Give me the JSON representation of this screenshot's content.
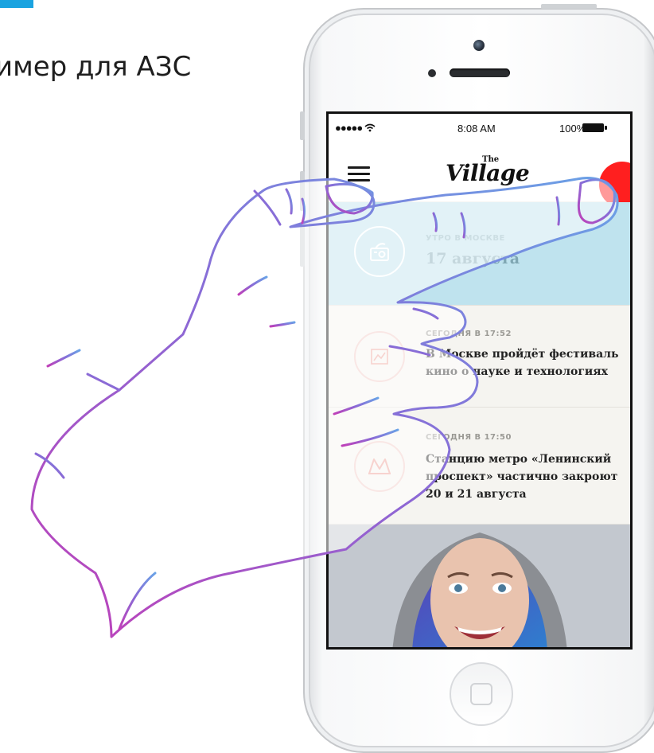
{
  "page": {
    "heading": "имер для АЗС"
  },
  "colors": {
    "accent": "#1aa3e0",
    "notify": "#ff1f1f",
    "feed_highlight": "#bfe3ee",
    "hand_stroke_start": "#b845c6",
    "hand_stroke_end": "#6fa0e0"
  },
  "status_bar": {
    "signal": "●●●●● ",
    "wifi_icon": "wifi-icon",
    "time": "8:08 AM",
    "battery": "100%"
  },
  "app_header": {
    "menu_icon": "hamburger-menu-icon",
    "logo_the": "The",
    "logo_name": "Village"
  },
  "feed": [
    {
      "meta": "Утро в Москве",
      "title": "17 августа",
      "icon": "radio-icon"
    },
    {
      "meta": "Сегодня в 17:52",
      "title": "В Москве пройдёт фестиваль кино о науке и технологиях",
      "icon": "picture-icon"
    },
    {
      "meta": "Сегодня в 17:50",
      "title": "Станцию метро «Ленинский проспект» частично закроют 20 и 21 августа",
      "icon": "metro-icon"
    }
  ]
}
